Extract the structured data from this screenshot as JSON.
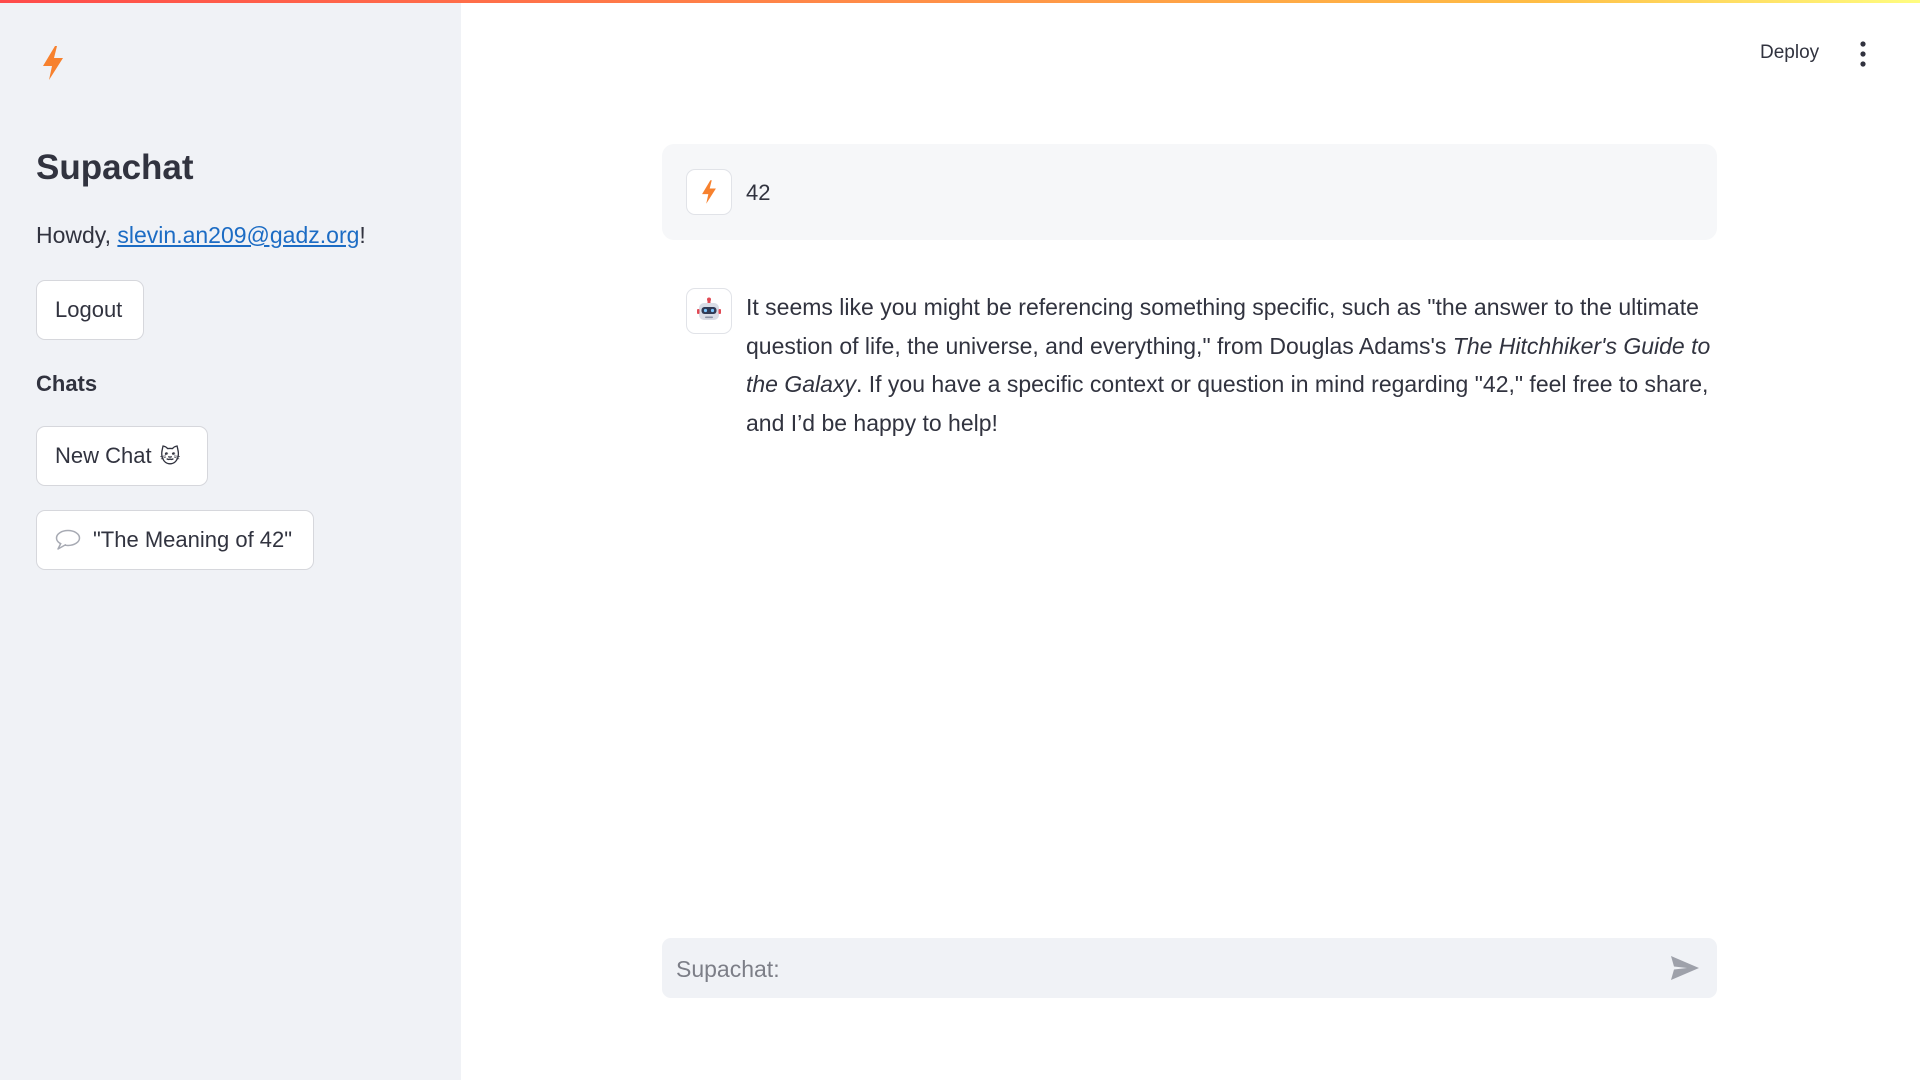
{
  "app": {
    "accent": "#f7812e",
    "link_color": "#1c6cc4"
  },
  "sidebar": {
    "logo_icon": "lightning-icon",
    "title": "Supachat",
    "greeting_prefix": "Howdy, ",
    "user_email": "slevin.an209@gadz.org",
    "greeting_suffix": "!",
    "logout_label": "Logout",
    "chats_heading": "Chats",
    "new_chat_label": "New Chat",
    "new_chat_emoji": "🐱",
    "chat_items": [
      {
        "icon": "speech-bubble-icon",
        "emoji": "💬",
        "label": "\"The Meaning of 42\""
      }
    ]
  },
  "header": {
    "deploy_label": "Deploy",
    "menu_icon": "kebab-menu-icon"
  },
  "messages": {
    "user": {
      "avatar_icon": "lightning-icon",
      "text": "42"
    },
    "assistant": {
      "avatar_icon": "robot-icon",
      "text_part1": "It seems like you might be referencing something specific, such as \"the answer to the ultimate question of life, the universe, and everything,\" from Douglas Adams's ",
      "text_italic": "The Hitchhiker's Guide to the Galaxy",
      "text_part2": ". If you have a specific context or question in mind regarding \"42,\" feel free to share, and I’d be happy to help!"
    }
  },
  "chat_input": {
    "placeholder": "Supachat:",
    "value": "",
    "send_icon": "send-icon"
  }
}
